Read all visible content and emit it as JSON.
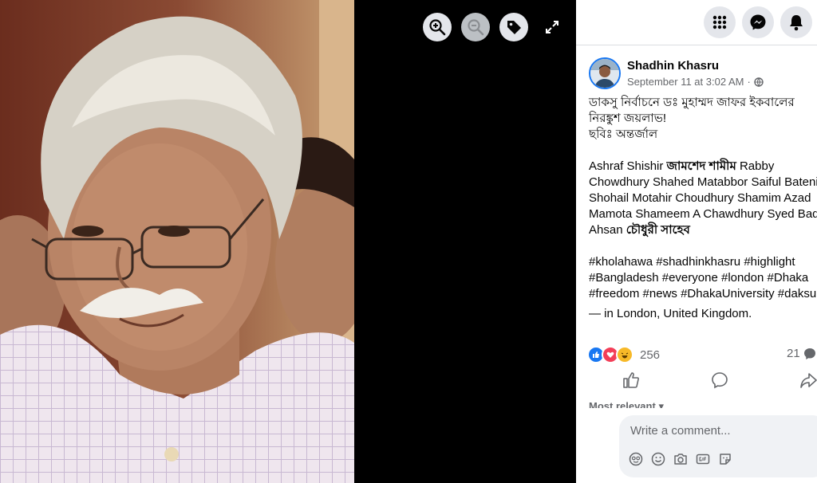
{
  "post": {
    "author": "Shadhin Khasru",
    "time": "September 11 at 3:02 AM",
    "time_sep": "·",
    "text_lines": [
      "ডাকসু নির্বাচনে ডঃ মুহাম্মদ জাফর ইকবালের",
      "নিরঙ্কুশ জয়লাভ!",
      "ছবিঃ অন্তর্জাল"
    ],
    "tags": {
      "t1": "Ashraf Shishir",
      "t2": "জামশেদ শামীম",
      "t3": "Rabby",
      "t4": "Chowdhury Shahed Matabbor",
      "t5": "Saiful Bateni",
      "t6": "Shohail Motahir Choudhury",
      "t7": "Shamim Azad",
      "t8": "Mamota Shameem",
      "t9": "A Chawdhury",
      "t10": "Syed Bad",
      "t11": "Ahsan",
      "t12": "চৌধুরী সাহেব"
    },
    "hashtags": {
      "h1": "#kholahawa",
      "h2": "#shadhinkhasru",
      "h3": "#highlight",
      "h4": "#Bangladesh",
      "h5": "#everyone",
      "h6": "#london",
      "h7": "#Dhaka",
      "h8": "#freedom",
      "h9": "#news",
      "h10": "#DhakaUniversity",
      "h11": "#daksu"
    },
    "checkin_prefix": "— in",
    "checkin_place": "London, United Kingdom",
    "checkin_suffix": ".",
    "reactions_count": "256",
    "comments_count": "21"
  },
  "comments": {
    "sort_label": "Most relevant",
    "placeholder": "Write a comment..."
  },
  "icons": {
    "zoom_in": "zoom-in-icon",
    "zoom_out": "zoom-out-icon",
    "tag": "tag-icon",
    "fullscreen": "expand-icon",
    "menu": "menu-grid-icon",
    "messenger": "messenger-icon",
    "notifications": "bell-icon",
    "privacy": "globe-icon"
  },
  "colors": {
    "accent": "#1877f2",
    "like": "#1877f2",
    "love": "#f33e58",
    "haha": "#f7b928"
  }
}
